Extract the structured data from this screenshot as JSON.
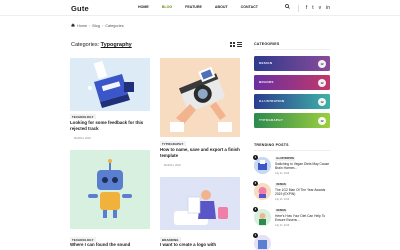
{
  "header": {
    "logo": "Gute",
    "nav": [
      "HOME",
      "BLOG",
      "FEATURE",
      "ABOUT",
      "CONTACT"
    ],
    "active_nav": "BLOG",
    "accent_color": "#6c8f24",
    "icons": [
      "search-icon",
      "facebook-icon",
      "twitter-icon",
      "vimeo-icon",
      "linkedin-icon"
    ]
  },
  "breadcrumb": [
    "Home",
    "Blog",
    "Categories"
  ],
  "page": {
    "heading_prefix": "Categories:",
    "heading_term": "Typography"
  },
  "posts": [
    {
      "tag": "TECHNOLOGY",
      "title": "Looking for some feedback for this rejected track",
      "date": "MARCH, 2019"
    },
    {
      "tag": "TYPOGRAPHY",
      "title": "How to name, save and export a finish template",
      "date": "MARCH, 2019"
    },
    {
      "tag": "TECHNOLOGY",
      "title": "Where I can found the sound",
      "date": ""
    },
    {
      "tag": "BRANDING",
      "title": "I want to create a logo with",
      "date": ""
    }
  ],
  "sidebar": {
    "categories_heading": "CATEGORIES",
    "categories": [
      {
        "name": "DESIGN",
        "count": "12",
        "colors": [
          "#2d3a8c",
          "#8a4b9a"
        ]
      },
      {
        "name": "BRANDS",
        "count": "12",
        "colors": [
          "#6b2fa0",
          "#c0396b"
        ]
      },
      {
        "name": "ILLUSTRATION",
        "count": "12",
        "colors": [
          "#2a3c8f",
          "#3fb1a6"
        ]
      },
      {
        "name": "TYPOGRAPHY",
        "count": "12",
        "colors": [
          "#2c8a4e",
          "#9ccf3f"
        ]
      }
    ],
    "trending_heading": "TRENDING POSTS",
    "trending": [
      {
        "num": "1",
        "tag": "ILLUSTRATION",
        "title": "Switching to Vegan Diets May Cause Brain Harmm...",
        "date": "July 21, 2019"
      },
      {
        "num": "2",
        "tag": "DESIGN",
        "title": "The 1G2 Man Of The Year Awards 2019 (EXPIN)",
        "date": "July 21, 2019"
      },
      {
        "num": "3",
        "tag": "DESIGN",
        "title": "Here's How Your Diet Can Help To Ensure Essenc...",
        "date": "July 21, 2019"
      },
      {
        "num": "4",
        "tag": "",
        "title": "",
        "date": ""
      }
    ]
  }
}
